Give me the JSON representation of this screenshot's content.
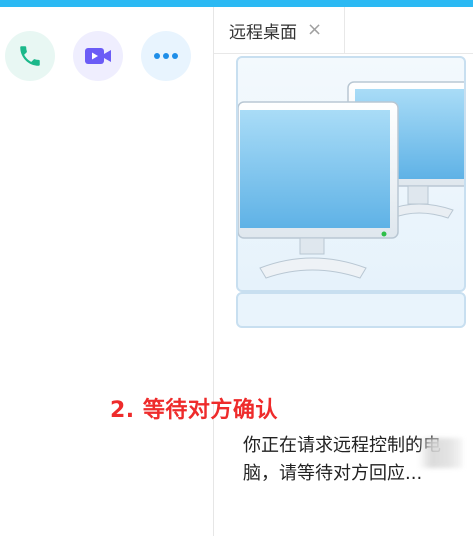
{
  "call_toolbar": {
    "buttons": [
      {
        "name": "phone-icon",
        "color": "#1bb88a"
      },
      {
        "name": "video-camera-icon",
        "color": "#6b5cf6"
      },
      {
        "name": "more-icon",
        "color": "#1e8ee8"
      }
    ]
  },
  "tabs": [
    {
      "label": "远程桌面",
      "close": "×"
    }
  ],
  "annotation": {
    "text": "2. 等待对方确认",
    "color": "#ee2b2b"
  },
  "status": {
    "message": "你正在请求远程控制的电脑，请等待对方回应..."
  },
  "colors": {
    "top_bar": "#2bb9f3",
    "monitor_screen": "#7cc4ef"
  }
}
